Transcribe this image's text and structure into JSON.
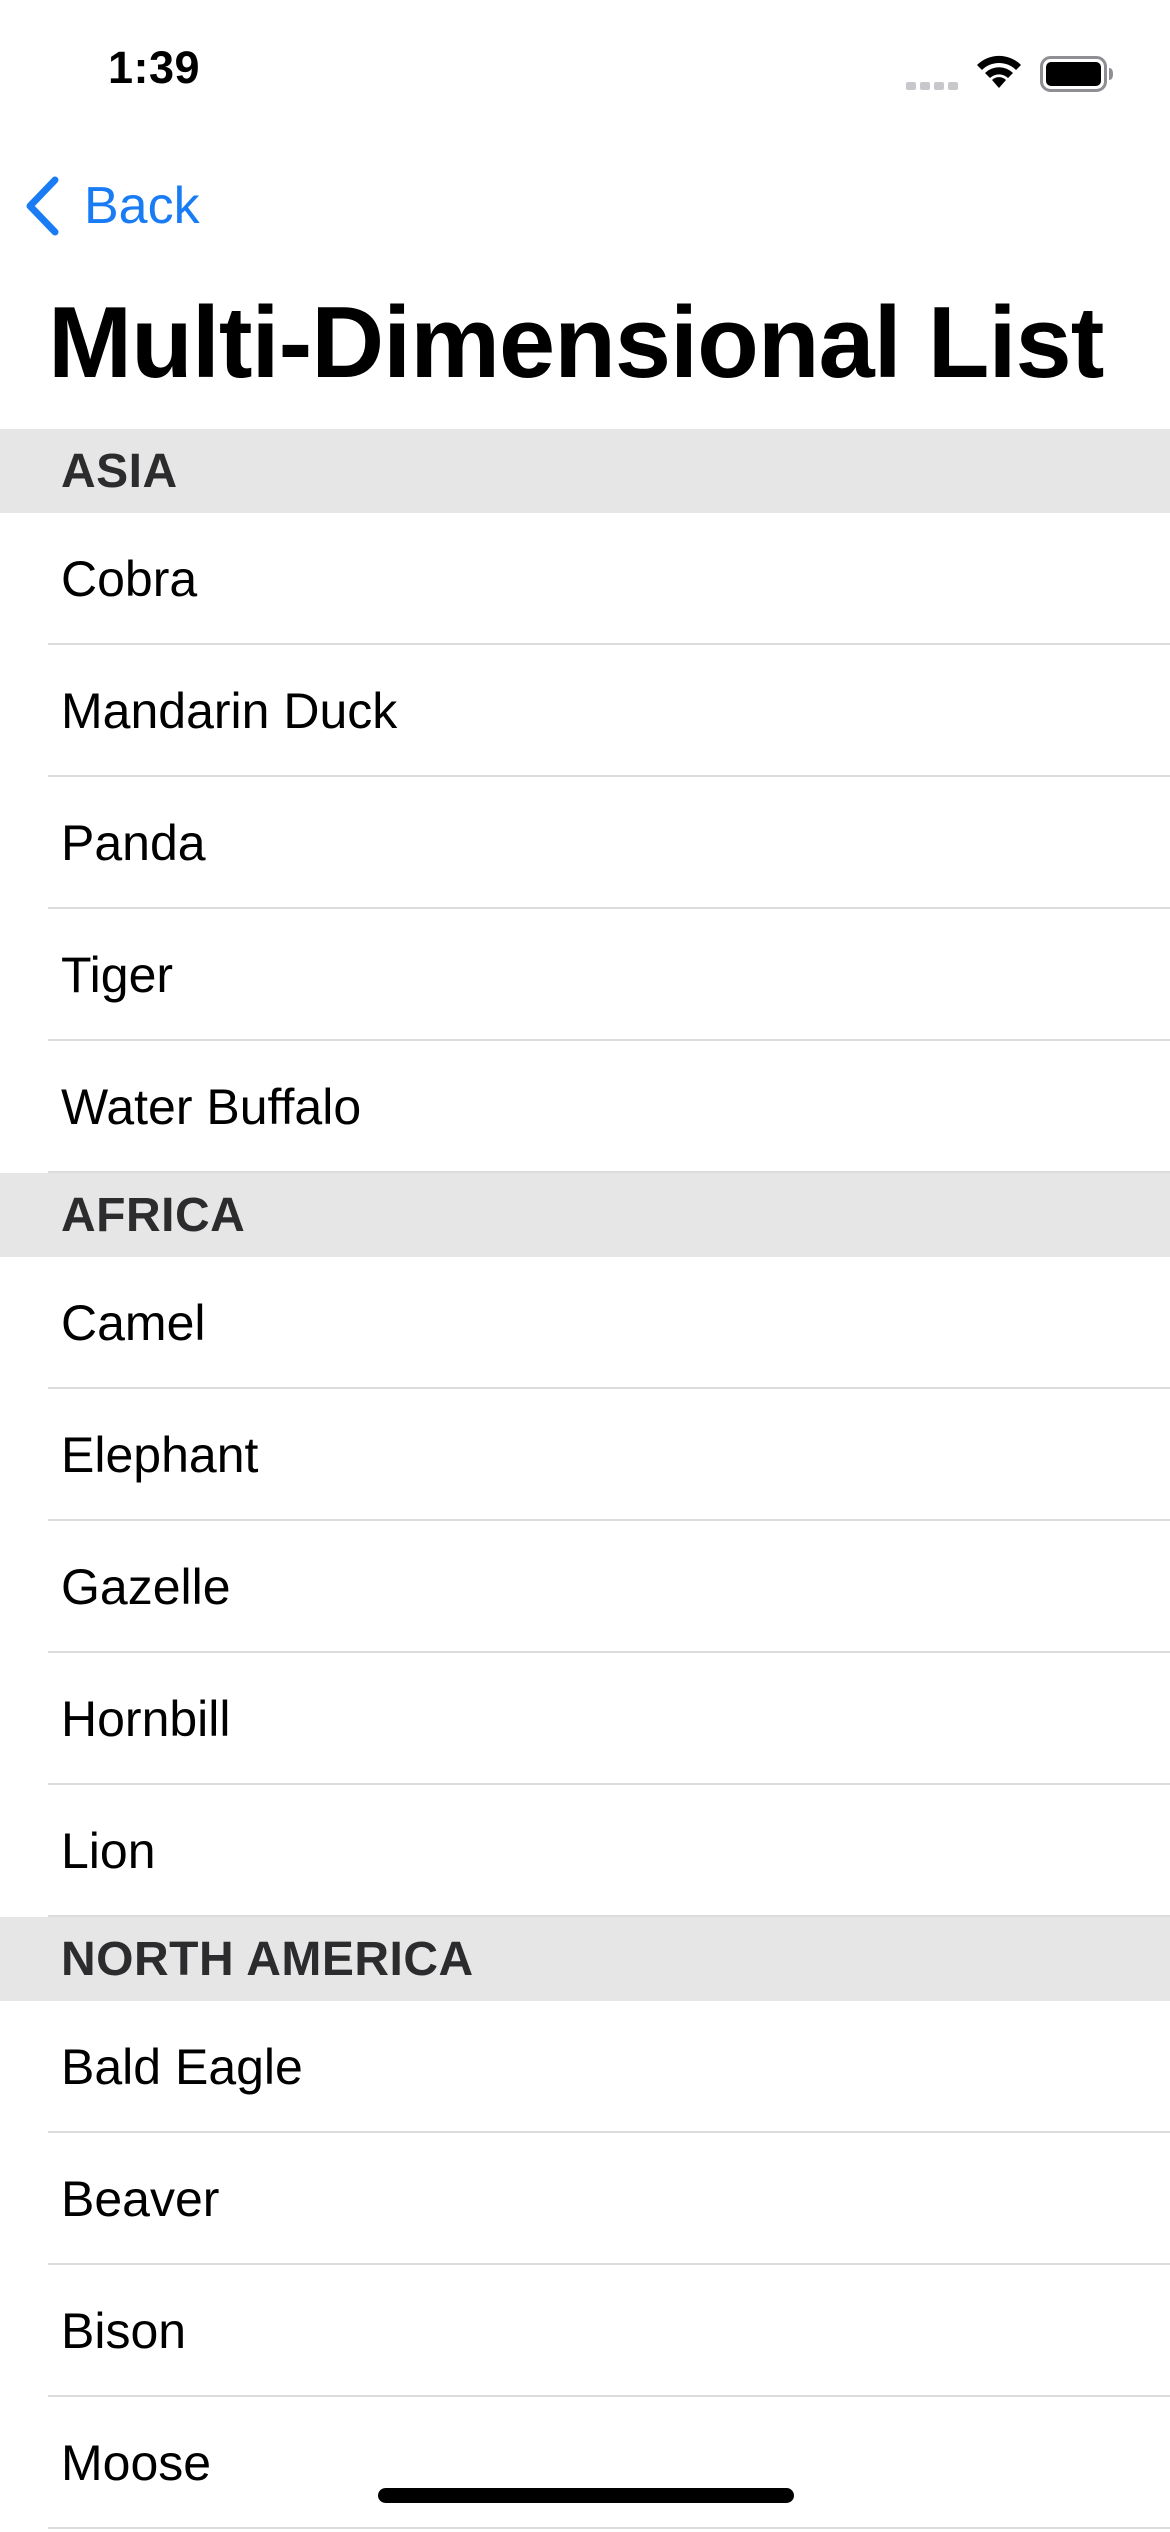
{
  "status_bar": {
    "time": "1:39",
    "icons": [
      "cellular-signal-icon",
      "wifi-icon",
      "battery-icon"
    ]
  },
  "nav": {
    "back_label": "Back",
    "title": "Multi-Dimensional List"
  },
  "colors": {
    "accent": "#1a7cf4",
    "section_header_bg": "#e6e6e6",
    "separator": "#dcdcde"
  },
  "sections": [
    {
      "header": "ASIA",
      "items": [
        "Cobra",
        "Mandarin Duck",
        "Panda",
        "Tiger",
        "Water Buffalo"
      ]
    },
    {
      "header": "AFRICA",
      "items": [
        "Camel",
        "Elephant",
        "Gazelle",
        "Hornbill",
        "Lion"
      ]
    },
    {
      "header": "NORTH AMERICA",
      "items": [
        "Bald Eagle",
        "Beaver",
        "Bison",
        "Moose"
      ]
    }
  ]
}
